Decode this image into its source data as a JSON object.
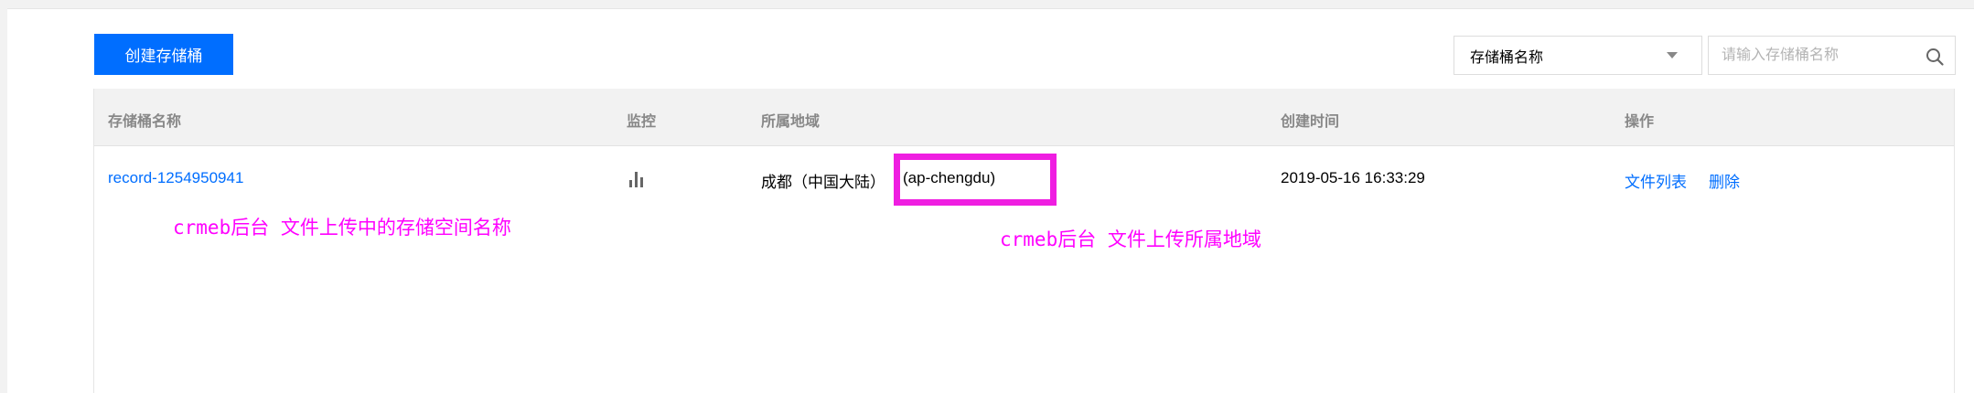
{
  "toolbar": {
    "create_button_label": "创建存储桶",
    "filter_select_value": "存储桶名称",
    "search_placeholder": "请输入存储桶名称"
  },
  "table": {
    "columns": [
      "存储桶名称",
      "监控",
      "所属地域",
      "创建时间",
      "操作"
    ],
    "rows": [
      {
        "name": "record-1254950941",
        "monitor_icon": "bar-chart-icon",
        "region_name": "成都（中国大陆）",
        "region_code": "(ap-chengdu)",
        "created": "2019-05-16 16:33:29",
        "actions": [
          "文件列表",
          "删除"
        ]
      }
    ]
  },
  "annotations": {
    "bucket_name_note": "crmeb后台 文件上传中的存储空间名称",
    "region_note": "crmeb后台 文件上传所属地域"
  },
  "colors": {
    "primary": "#006eff",
    "annotation": "#ff00ff",
    "highlight_border": "#ef1ee1",
    "header_bg": "#f2f2f2"
  }
}
